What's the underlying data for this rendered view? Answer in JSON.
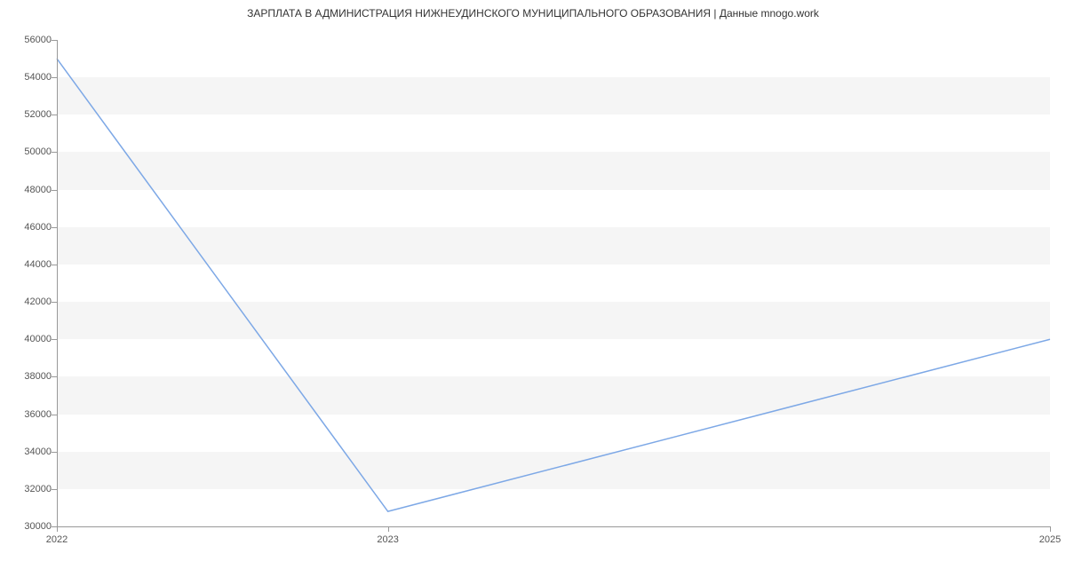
{
  "chart_data": {
    "type": "line",
    "title": "ЗАРПЛАТА В АДМИНИСТРАЦИЯ НИЖНЕУДИНСКОГО МУНИЦИПАЛЬНОГО ОБРАЗОВАНИЯ | Данные mnogo.work",
    "x": [
      "2022",
      "2023",
      "2025"
    ],
    "values": [
      55000,
      30800,
      40000
    ],
    "xlabel": "",
    "ylabel": "",
    "x_ticks": [
      "2022",
      "2023",
      "2025"
    ],
    "y_ticks": [
      30000,
      32000,
      34000,
      36000,
      38000,
      40000,
      42000,
      44000,
      46000,
      48000,
      50000,
      52000,
      54000,
      56000
    ],
    "ylim": [
      30000,
      56000
    ],
    "grid": "horizontal-bands"
  }
}
